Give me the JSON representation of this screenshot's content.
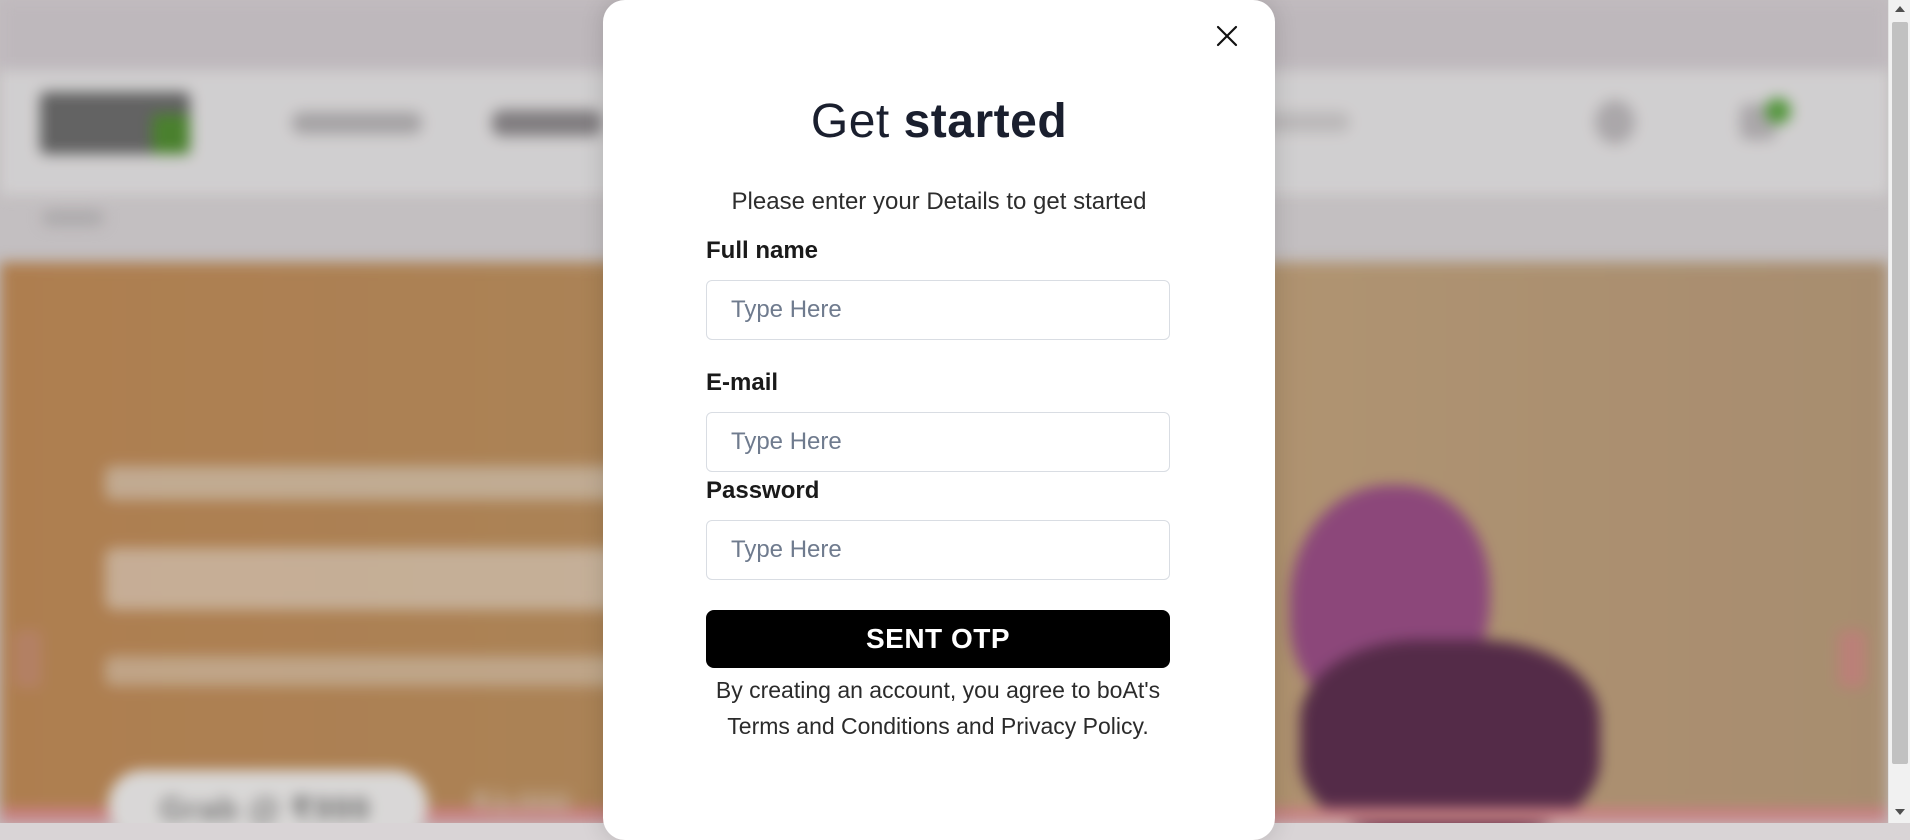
{
  "background": {
    "banner_cta": "Grab @ ₹999",
    "banner_strike_price": "₹3,990"
  },
  "modal": {
    "title_part1": "Get",
    "title_part2": "started",
    "subtitle": "Please enter your Details to get started",
    "fields": [
      {
        "label": "Full name",
        "placeholder": "Type Here",
        "value": ""
      },
      {
        "label": "E-mail",
        "placeholder": "Type Here",
        "value": ""
      },
      {
        "label": "Password",
        "placeholder": "Type Here",
        "value": ""
      }
    ],
    "submit_label": "SENT OTP",
    "terms_line1": "By creating an account, you agree to boAt's",
    "terms_line2": "Terms and Conditions and Privacy Policy.",
    "close_icon": "close-icon"
  },
  "colors": {
    "button_bg": "#000000",
    "title": "#1a1f2e",
    "placeholder": "#6f7b8e",
    "banner_accent": "#c18a55"
  }
}
